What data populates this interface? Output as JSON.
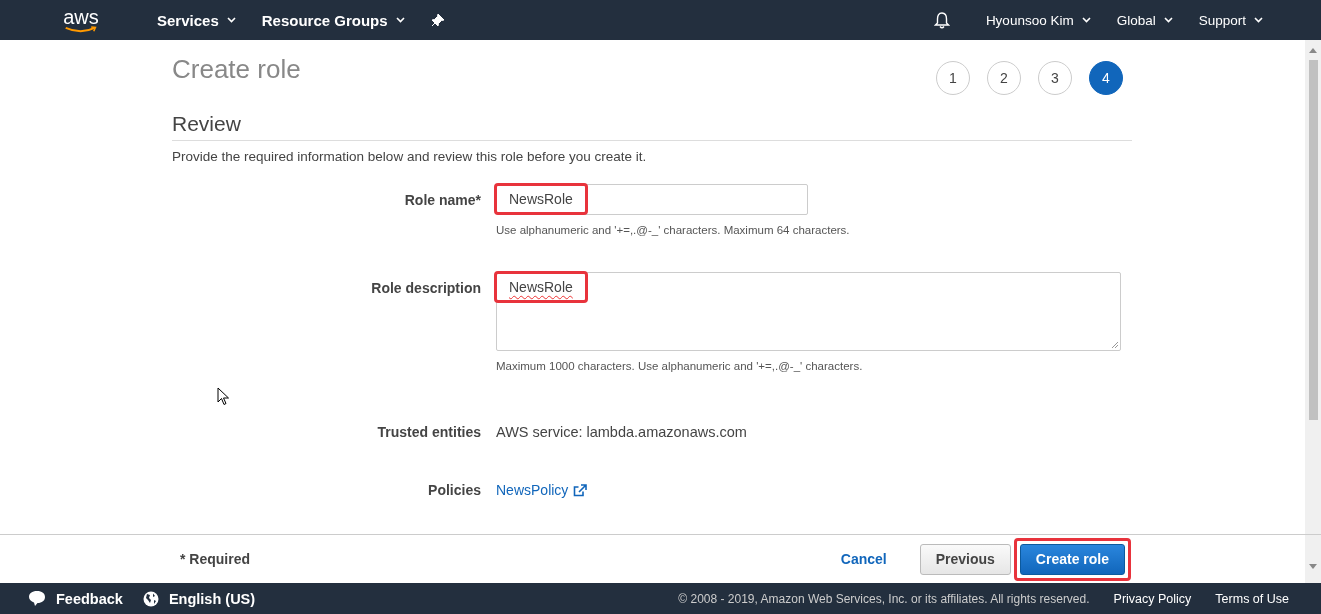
{
  "nav": {
    "logo": "aws",
    "menus": [
      {
        "label": "Services"
      },
      {
        "label": "Resource Groups"
      }
    ],
    "user_menus": [
      {
        "label": "Hyounsoo Kim"
      },
      {
        "label": "Global"
      },
      {
        "label": "Support"
      }
    ]
  },
  "page": {
    "title": "Create role",
    "steps": [
      {
        "label": "1",
        "selected": false
      },
      {
        "label": "2",
        "selected": false
      },
      {
        "label": "3",
        "selected": false
      },
      {
        "label": "4",
        "selected": true
      }
    ],
    "section": "Review",
    "intro": "Provide the required information below and review this role before you create it.",
    "fields": [
      {
        "kind": "input",
        "label": "Role name*",
        "value": "NewsRole",
        "hint": "Use alphanumeric and '+=,.@-_' characters. Maximum 64 characters.",
        "highlighted": true
      },
      {
        "kind": "textarea",
        "label": "Role description",
        "value": "NewsRole",
        "hint": "Maximum 1000 characters. Use alphanumeric and '+=,.@-_' characters.",
        "highlighted": true
      },
      {
        "kind": "text",
        "label": "Trusted entities",
        "value": "AWS service: lambda.amazonaws.com"
      },
      {
        "kind": "link",
        "label": "Policies",
        "value": "NewsPolicy"
      }
    ]
  },
  "actions": {
    "required_note": "* Required",
    "buttons": [
      {
        "kind": "link",
        "label": "Cancel",
        "highlighted": false
      },
      {
        "kind": "secondary",
        "label": "Previous",
        "highlighted": false
      },
      {
        "kind": "primary",
        "label": "Create role",
        "highlighted": true
      }
    ]
  },
  "footer": {
    "feedback": "Feedback",
    "language": "English (US)",
    "copyright": "© 2008 - 2019, Amazon Web Services, Inc. or its affiliates. All rights reserved.",
    "links": [
      "Privacy Policy",
      "Terms of Use"
    ]
  }
}
